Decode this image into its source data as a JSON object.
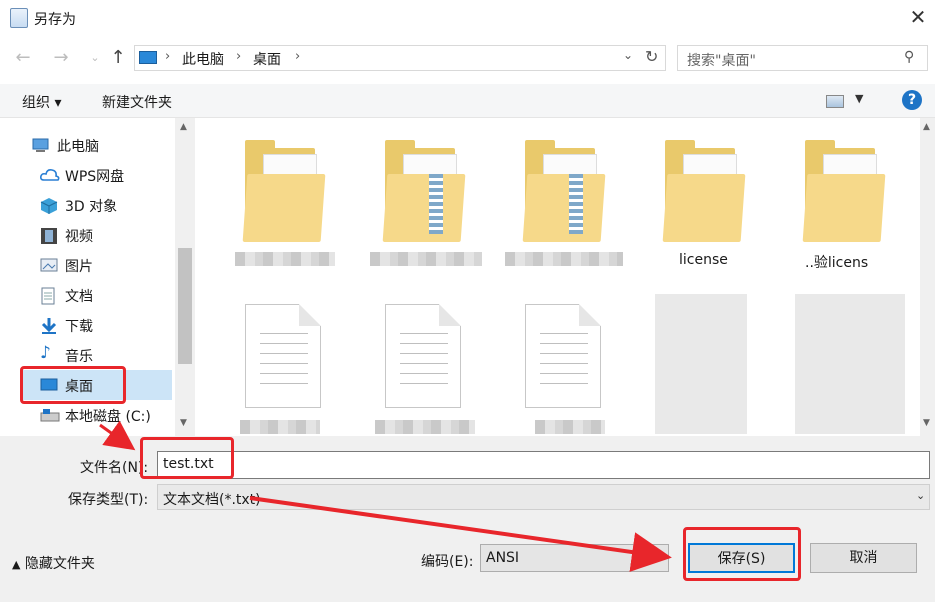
{
  "window": {
    "title": "另存为",
    "close_glyph": "✕"
  },
  "nav": {
    "back_icon": "back-arrow-icon",
    "forward_icon": "forward-arrow-icon",
    "recent_icon": "chevron-down-icon",
    "up_icon": "up-arrow-icon",
    "breadcrumb": [
      "此电脑",
      "桌面"
    ],
    "search_placeholder": "搜索\"桌面\""
  },
  "toolbar": {
    "organize": "组织 ▾",
    "new_folder": "新建文件夹",
    "help": "?"
  },
  "sidebar": {
    "items": [
      {
        "label": "此电脑",
        "icon": "computer-icon"
      },
      {
        "label": "WPS网盘",
        "icon": "cloud-icon"
      },
      {
        "label": "3D 对象",
        "icon": "cube-icon"
      },
      {
        "label": "视频",
        "icon": "film-icon"
      },
      {
        "label": "图片",
        "icon": "picture-icon"
      },
      {
        "label": "文档",
        "icon": "document-icon"
      },
      {
        "label": "下载",
        "icon": "download-arrow-icon"
      },
      {
        "label": "音乐",
        "icon": "music-note-icon"
      },
      {
        "label": "桌面",
        "icon": "desktop-icon",
        "selected": true
      },
      {
        "label": "本地磁盘 (C:)",
        "icon": "drive-icon"
      }
    ]
  },
  "files": {
    "row1": [
      {
        "type": "folder",
        "name": ""
      },
      {
        "type": "folder-doc",
        "name": ""
      },
      {
        "type": "folder-doc",
        "name": ""
      },
      {
        "type": "folder",
        "name": "license"
      },
      {
        "type": "folder",
        "name": "..验licens"
      }
    ],
    "row2": [
      {
        "type": "text-file",
        "name": ""
      },
      {
        "type": "text-file",
        "name": ""
      },
      {
        "type": "text-file",
        "name": ""
      },
      {
        "type": "blurred",
        "name": ""
      },
      {
        "type": "blurred",
        "name": ""
      }
    ]
  },
  "form": {
    "filename_label": "文件名(N):",
    "filename_value": "test.txt",
    "filetype_label": "保存类型(T):",
    "filetype_value": "文本文档(*.txt)",
    "hide_folders": "隐藏文件夹",
    "encoding_label": "编码(E):",
    "encoding_value": "ANSI",
    "save": "保存(S)",
    "cancel": "取消"
  },
  "colors": {
    "annotation": "#e8262b",
    "accent": "#0078d7",
    "selected_bg": "#cce4f7"
  }
}
